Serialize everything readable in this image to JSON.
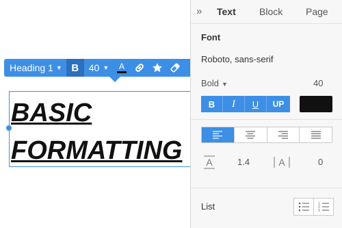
{
  "canvas": {
    "toolbar": {
      "text_style": "Heading 1",
      "bold_label": "B",
      "font_size": "40",
      "icons": [
        "caret-down-icon",
        "text-color-icon",
        "link-icon",
        "star-icon",
        "eraser-icon"
      ]
    },
    "heading_lines": [
      "BASIC",
      "FORMATTING"
    ]
  },
  "panel": {
    "tabs": [
      {
        "label": "Text",
        "active": true
      },
      {
        "label": "Block",
        "active": false
      },
      {
        "label": "Page",
        "active": false
      }
    ],
    "font": {
      "section_label": "Font",
      "family": "Roboto, sans-serif",
      "weight": "Bold",
      "size": "40",
      "format_buttons": [
        "B",
        "I",
        "U",
        "UP"
      ],
      "color": "#111111"
    },
    "alignment": {
      "options": [
        "align-left-icon",
        "align-center-icon",
        "align-right-icon",
        "align-justify-icon"
      ],
      "selected": "align-left-icon"
    },
    "spacing": {
      "line_height": "1.4",
      "letter_spacing": "0"
    },
    "list": {
      "label": "List",
      "options": [
        "bulleted-list-icon",
        "numbered-list-icon"
      ]
    }
  },
  "colors": {
    "accent": "#3d8fe6",
    "accent_dark": "#2b6fbf",
    "panel_bg": "#f7f7f7"
  }
}
